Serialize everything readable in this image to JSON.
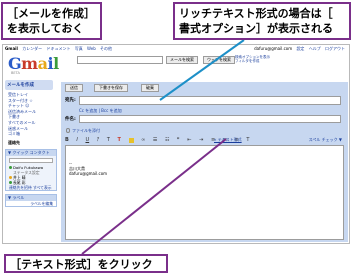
{
  "callouts": {
    "top_left": [
      "［メールを作成］",
      "を表示しておく"
    ],
    "top_right": [
      "リッチテキスト形式の場合は［",
      "書式オプション］が表示される"
    ],
    "bottom": "［テキスト形式］をクリック"
  },
  "colors": {
    "callout_border": "#7a2f8a",
    "pane_bg": "#c7d7f0",
    "link": "#1a3e9c"
  },
  "gmail": {
    "topnav": {
      "user": "Gmail",
      "links": [
        "カレンダー",
        "ドキュメント",
        "写真",
        "Web",
        "その他"
      ]
    },
    "toplinks": [
      "dafuru@gmail.com",
      "設定",
      "ヘルプ",
      "ログアウト"
    ],
    "logo": {
      "g": "G",
      "m": "m",
      "a": "a",
      "i": "i",
      "l": "l",
      "sub": "BETA"
    },
    "search_buttons": [
      "メールを検索",
      "ウェブを検索"
    ],
    "search_links": [
      "検索オプションを表示",
      "フィルタを作成"
    ],
    "compose_link": "メールを作成",
    "nav_items": [
      "受信トレイ",
      "スター付き ☆",
      "チャット ☺",
      "送信済みメール",
      "下書き",
      "すべてのメール",
      "迷惑メール",
      "ゴミ箱"
    ],
    "contacts": "連絡先",
    "quick_contacts": {
      "header": "▼ クイック コンタクト",
      "placeholder": "検索、追加、招待",
      "people": [
        {
          "name": "Daifu Fukukawa",
          "status": "ステータス設定"
        },
        {
          "name": "井上 晴",
          "status": "長尾 彩"
        }
      ],
      "link_invite": "連絡先を招待",
      "link_all": "すべて表示"
    },
    "labels": {
      "header": "▼ ラベル",
      "edit": "ラベルを編集"
    },
    "compose_buttons": [
      "送信",
      "下書きを保存",
      "破棄"
    ],
    "fields": {
      "to": "宛先:",
      "cc_bcc": "Cc を追加 | Bcc を追加",
      "subject": "件名:",
      "attach": "ファイルを添付"
    },
    "toolbar_icons": [
      "bold-icon",
      "italic-icon",
      "underline-icon",
      "font-icon",
      "font-size-icon",
      "text-color-icon",
      "highlight-icon",
      "link-icon",
      "numbered-list-icon",
      "bullet-list-icon",
      "quote-icon",
      "indent-less-icon",
      "indent-more-icon",
      "align-left-icon",
      "align-center-icon",
      "align-right-icon",
      "remove-format-icon"
    ],
    "plain_text_link": "« テキスト形式",
    "spell_check": "スペル チェック ▼",
    "signature": [
      "--",
      "吉川大貴",
      "dafuru@gmail.com"
    ]
  }
}
